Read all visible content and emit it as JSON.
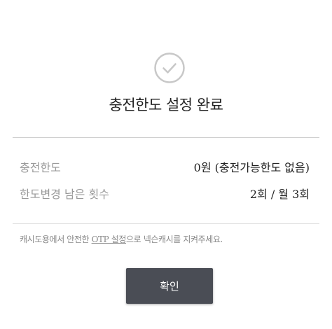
{
  "header": {
    "icon": "check-circle-icon",
    "title": "충전한도 설정 완료"
  },
  "info": {
    "rows": [
      {
        "label": "충전한도",
        "value": "0원 (충전가능한도 없음)"
      },
      {
        "label": "한도변경 남은 횟수",
        "value": "2회 / 월 3회"
      }
    ]
  },
  "notice": {
    "before": "캐시도용에서 안전한 ",
    "link": "OTP 설정",
    "after": "으로 넥슨캐시를 지켜주세요."
  },
  "actions": {
    "confirm_label": "확인"
  },
  "colors": {
    "icon_stroke": "#c8c8c8",
    "button_bg": "#4a4d55",
    "label_gray": "#999999",
    "text_dark": "#222222"
  }
}
